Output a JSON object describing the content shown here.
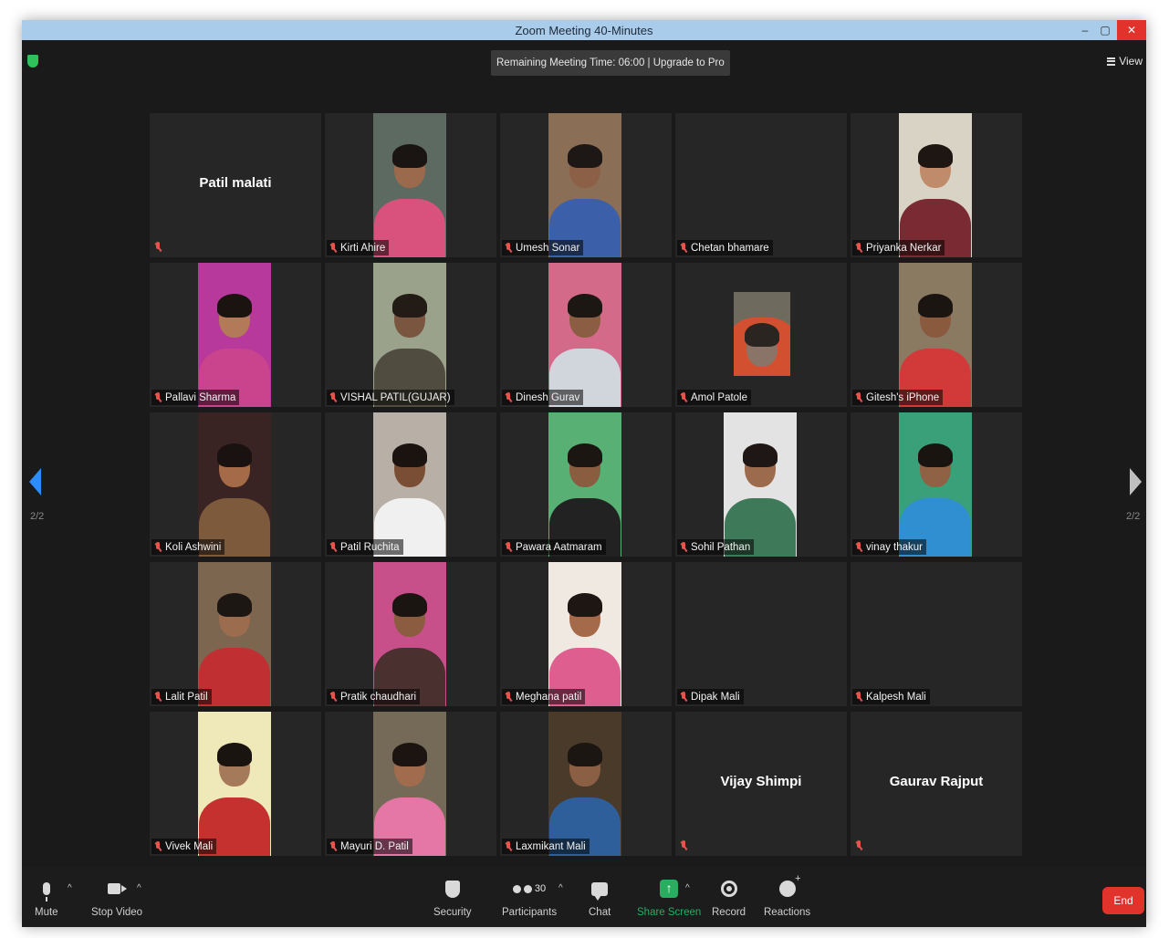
{
  "window": {
    "title": "Zoom Meeting 40-Minutes",
    "minimize": "–",
    "maximize": "▢",
    "close": "✕"
  },
  "header": {
    "remaining_time": "Remaining Meeting Time: 06:00 | Upgrade to Pro",
    "view_label": "View"
  },
  "pager": {
    "left_label": "2/2",
    "right_label": "2/2"
  },
  "participants": [
    {
      "name": "Patil malati",
      "video": false,
      "big_name": true
    },
    {
      "name": "Kirti Ahire",
      "video": true,
      "bg": "#5c6a62",
      "skin": "#9b6a4c",
      "hair": "#1a1413",
      "shirt": "#d9527d"
    },
    {
      "name": "Umesh Sonar",
      "video": true,
      "bg": "#8a6e55",
      "skin": "#8c6047",
      "hair": "#1d1816",
      "shirt": "#3b5fa8"
    },
    {
      "name": "Chetan bhamare",
      "video": false,
      "big_name": false
    },
    {
      "name": "Priyanka Nerkar",
      "video": true,
      "bg": "#d9d3c6",
      "skin": "#c08b6b",
      "hair": "#1e1612",
      "shirt": "#7a2a32"
    },
    {
      "name": "Pallavi Sharma",
      "video": true,
      "bg": "#b7399c",
      "skin": "#b37a5a",
      "hair": "#1b1310",
      "shirt": "#c9448d"
    },
    {
      "name": "VISHAL PATIL(GUJAR)",
      "video": true,
      "bg": "#9aa28b",
      "skin": "#7a5640",
      "hair": "#221b16",
      "shirt": "#514c40"
    },
    {
      "name": "Dinesh Gurav",
      "video": true,
      "bg": "#d46a8a",
      "skin": "#8b5d42",
      "hair": "#1d1714",
      "shirt": "#d1d6dd"
    },
    {
      "name": "Amol Patole",
      "video": true,
      "small": true,
      "bg": "#6f6a5e",
      "skin": "#8a7468",
      "hair": "#2b2522",
      "shirt": "#d2502f"
    },
    {
      "name": "Gitesh's iPhone",
      "video": true,
      "bg": "#8a7a62",
      "skin": "#8a5a3e",
      "hair": "#1b1512",
      "shirt": "#d23a3a"
    },
    {
      "name": "Koli Ashwini",
      "video": true,
      "bg": "#3a2323",
      "skin": "#a56b48",
      "hair": "#1a1210",
      "shirt": "#7d5a3c"
    },
    {
      "name": "Patil Ruchita",
      "video": true,
      "bg": "#b8b0a6",
      "skin": "#7a4e34",
      "hair": "#1a1310",
      "shirt": "#f0f0f0"
    },
    {
      "name": "Pawara Aatmaram",
      "video": true,
      "bg": "#58b074",
      "skin": "#8a5c40",
      "hair": "#1c1613",
      "shirt": "#222222"
    },
    {
      "name": "Sohil Pathan",
      "video": true,
      "bg": "#e3e3e3",
      "skin": "#9c6a4c",
      "hair": "#1e1715",
      "shirt": "#3e7a5a"
    },
    {
      "name": "vinay thakur",
      "video": true,
      "bg": "#3aa07a",
      "skin": "#8f6145",
      "hair": "#1a1411",
      "shirt": "#2f8fd0"
    },
    {
      "name": "Lalit Patil",
      "video": true,
      "bg": "#7c6650",
      "skin": "#9b6c4e",
      "hair": "#1d1714",
      "shirt": "#c02f31"
    },
    {
      "name": "Pratik chaudhari",
      "video": true,
      "bg": "#c8508a",
      "skin": "#8c5c41",
      "hair": "#1b1512",
      "shirt": "#4b3030"
    },
    {
      "name": "Meghana patil",
      "video": true,
      "bg": "#f0e9e2",
      "skin": "#a46a4a",
      "hair": "#1d1613",
      "shirt": "#de5f8f"
    },
    {
      "name": "Dipak Mali",
      "video": false,
      "big_name": false
    },
    {
      "name": "Kalpesh Mali",
      "video": false,
      "big_name": false
    },
    {
      "name": "Vivek Mali",
      "video": true,
      "bg": "#efe8b8",
      "skin": "#a47a5a",
      "hair": "#1a1411",
      "shirt": "#c5312e"
    },
    {
      "name": "Mayuri D. Patil",
      "video": true,
      "bg": "#756a57",
      "skin": "#a06c4d",
      "hair": "#1b1411",
      "shirt": "#e577a6"
    },
    {
      "name": "Laxmikant Mali",
      "video": true,
      "bg": "#4a3a2a",
      "skin": "#8b5f44",
      "hair": "#1c1613",
      "shirt": "#2e5f9a"
    },
    {
      "name": "Vijay Shimpi",
      "video": false,
      "big_name": true,
      "name_hidden": true
    },
    {
      "name": "Gaurav Rajput",
      "video": false,
      "big_name": true,
      "name_hidden": true
    }
  ],
  "toolbar": {
    "mute": "Mute",
    "stop_video": "Stop Video",
    "security": "Security",
    "participants_label": "Participants",
    "participants_count": "30",
    "chat": "Chat",
    "share_screen": "Share Screen",
    "record": "Record",
    "reactions": "Reactions",
    "end": "End",
    "caret": "^"
  },
  "colors": {
    "accent": "#2d8cff",
    "share_green": "#27ae60",
    "end_red": "#e1322c",
    "muted_red": "#e5534b"
  }
}
